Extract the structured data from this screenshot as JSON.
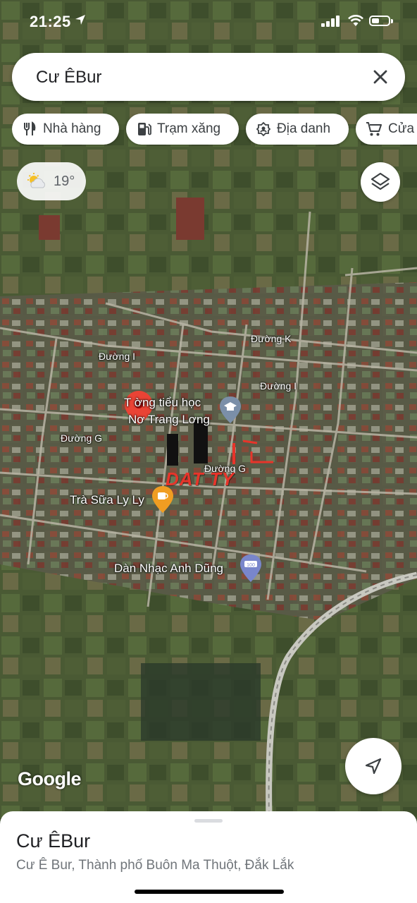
{
  "status_bar": {
    "time": "21:25"
  },
  "search": {
    "query": "Cư ÊBur"
  },
  "chips": [
    {
      "label": "Nhà hàng",
      "icon": "restaurant-icon"
    },
    {
      "label": "Trạm xăng",
      "icon": "gas-station-icon"
    },
    {
      "label": "Địa danh",
      "icon": "landmark-icon"
    },
    {
      "label": "Cửa",
      "icon": "shopping-cart-icon"
    }
  ],
  "weather": {
    "temperature": "19°"
  },
  "map": {
    "place_labels": {
      "school": "Trường tiểu học Nơ Trang Lơng",
      "school_line1": "T    ờng tiểu học",
      "school_line2": "Nơ Trang Lơng",
      "milk_tea": "Trà Sữa Ly Ly",
      "band": "Dàn Nhạc Anh Dũng"
    },
    "streets": {
      "k": "Đường K",
      "i_left": "Đường I",
      "i_right": "Đường I",
      "g_left": "Đường G",
      "g_right": "Đường G"
    },
    "watermark": "DAT TY",
    "attribution": "Google"
  },
  "place_sheet": {
    "title": "Cư ÊBur",
    "address": "Cư Ê Bur, Thành phố Buôn Ma Thuột, Đắk Lắk"
  },
  "colors": {
    "pin": "#ea4335",
    "watermark": "#e8342a",
    "terrain": "#3a4a2a"
  }
}
